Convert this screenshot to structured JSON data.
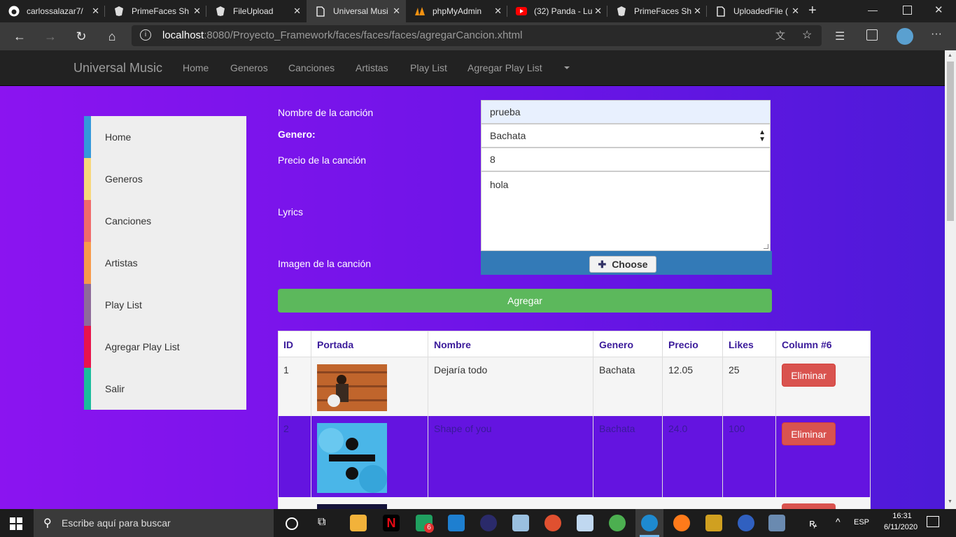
{
  "browser": {
    "tabs": [
      {
        "title": "carlossalazar7/",
        "icon": "github-icon"
      },
      {
        "title": "PrimeFaces Sh",
        "icon": "primefaces-icon"
      },
      {
        "title": "FileUpload",
        "icon": "primefaces-icon"
      },
      {
        "title": "Universal Musi",
        "icon": "page-icon"
      },
      {
        "title": "phpMyAdmin",
        "icon": "phpmyadmin-icon"
      },
      {
        "title": "(32) Panda - Lu",
        "icon": "youtube-icon"
      },
      {
        "title": "PrimeFaces Sh",
        "icon": "primefaces-icon"
      },
      {
        "title": "UploadedFile (",
        "icon": "page-icon"
      }
    ],
    "url_host": "localhost",
    "url_rest": ":8080/Proyecto_Framework/faces/faces/faces/agregarCancion.xhtml"
  },
  "navbar": {
    "brand": "Universal Music",
    "links": [
      "Home",
      "Generos",
      "Canciones",
      "Artistas",
      "Play List",
      "Agregar Play List"
    ]
  },
  "sidebar": {
    "items": [
      {
        "label": "Home",
        "color": "#3498db"
      },
      {
        "label": "Generos",
        "color": "#f7d77a"
      },
      {
        "label": "Canciones",
        "color": "#f06a6a"
      },
      {
        "label": "Artistas",
        "color": "#f79a4a"
      },
      {
        "label": "Play List",
        "color": "#8e6a9a"
      },
      {
        "label": "Agregar Play List",
        "color": "#e8134b"
      },
      {
        "label": "Salir",
        "color": "#1abc9c"
      }
    ]
  },
  "form": {
    "nombre_label": "Nombre de la canción",
    "nombre_value": "prueba",
    "genero_label": "Genero:",
    "genero_value": "Bachata",
    "precio_label": "Precio de la canción",
    "precio_value": "8",
    "lyrics_label": "Lyrics",
    "lyrics_value": "hola",
    "imagen_label": "Imagen de la canción",
    "choose_label": "Choose",
    "submit_label": "Agregar"
  },
  "table": {
    "headers": [
      "ID",
      "Portada",
      "Nombre",
      "Genero",
      "Precio",
      "Likes",
      "Column #6"
    ],
    "rows": [
      {
        "id": "1",
        "nombre": "Dejaría todo",
        "genero": "Bachata",
        "precio": "12.05",
        "likes": "25",
        "action": "Eliminar"
      },
      {
        "id": "2",
        "nombre": "Shape of you",
        "genero": "Bachata",
        "precio": "24.0",
        "likes": "100",
        "action": "Eliminar"
      }
    ]
  },
  "taskbar": {
    "search_placeholder": "Escribe aquí para buscar",
    "lang": "ESP",
    "time": "16:31",
    "date": "6/11/2020",
    "badge": "6"
  }
}
